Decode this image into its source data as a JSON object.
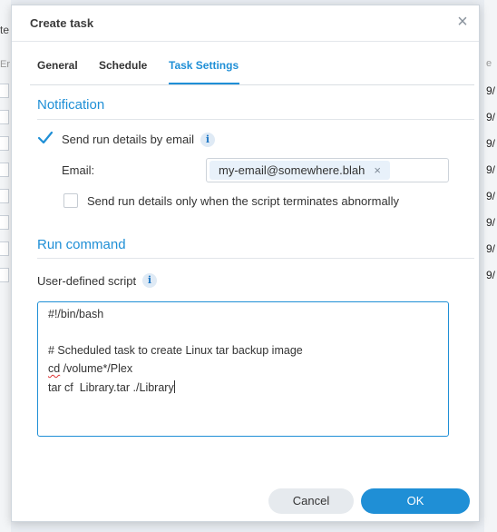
{
  "dialog": {
    "title": "Create task",
    "close_glyph": "×"
  },
  "tabs": [
    {
      "label": "General",
      "active": false
    },
    {
      "label": "Schedule",
      "active": false
    },
    {
      "label": "Task Settings",
      "active": true
    }
  ],
  "notification": {
    "heading": "Notification",
    "send_details": {
      "label": "Send run details by email",
      "checked": true
    },
    "email_label": "Email:",
    "email_value": "my-email@somewhere.blah",
    "abnormal_only": {
      "label": "Send run details only when the script terminates abnormally",
      "checked": false
    }
  },
  "run_command": {
    "heading": "Run command",
    "script_label": "User-defined script",
    "script_lines": [
      "#!/bin/bash",
      "",
      "# Scheduled task to create Linux tar backup image",
      "cd /volume*/Plex",
      "tar cf  Library.tar ./Library"
    ]
  },
  "footer": {
    "cancel_label": "Cancel",
    "ok_label": "OK"
  },
  "background": {
    "left_fragments": [
      "te",
      "Er"
    ],
    "right_fragments": [
      "e",
      "9/",
      "9/",
      "9/",
      "9/",
      "9/",
      "9/",
      "9/",
      "9/"
    ]
  },
  "colors": {
    "accent": "#1f8fd6",
    "chip_bg": "#e8f1fa",
    "cancel_bg": "#e6eaee"
  },
  "icons": {
    "checkmark": "check-icon",
    "info": "info-icon",
    "close": "close-icon",
    "chip_remove": "remove-icon"
  }
}
